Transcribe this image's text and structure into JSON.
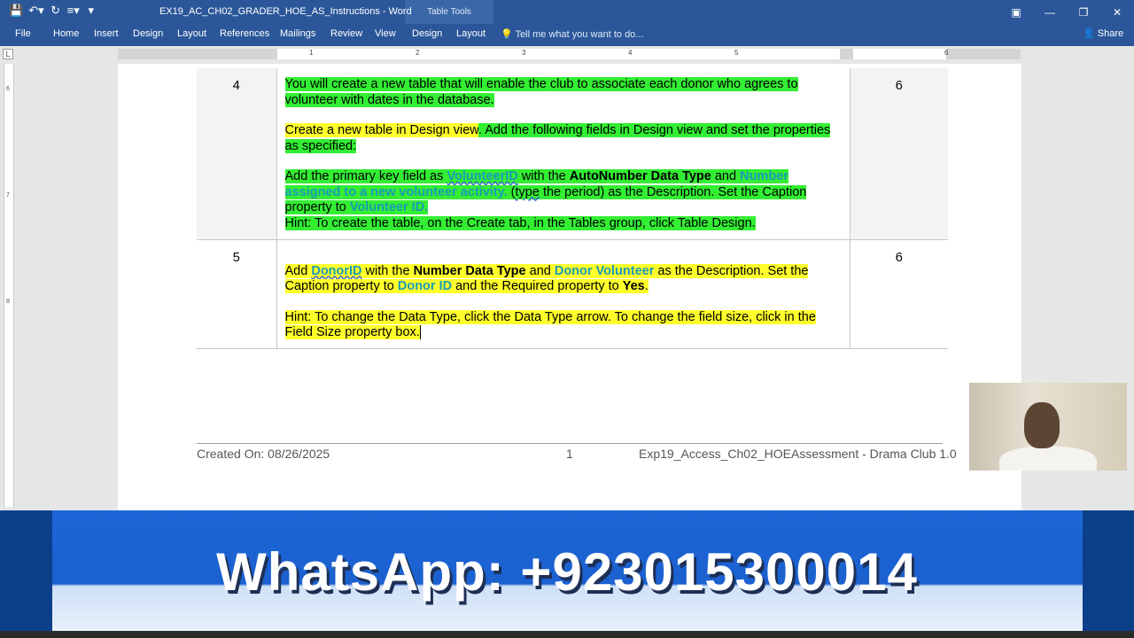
{
  "titlebar": {
    "title": "EX19_AC_CH02_GRADER_HOE_AS_Instructions - Word",
    "table_tools": "Table Tools",
    "qat_icons": [
      "save-icon",
      "undo-icon",
      "redo-icon",
      "numbering-icon",
      "customize-icon"
    ],
    "window_controls": [
      "ribbon-display-icon",
      "minimize-icon",
      "restore-icon",
      "close-icon"
    ]
  },
  "ribbon": {
    "tabs": [
      "File",
      "Home",
      "Insert",
      "Design",
      "Layout",
      "References",
      "Mailings",
      "Review",
      "View",
      "Design",
      "Layout"
    ],
    "tell_me": "Tell me what you want to do...",
    "share": "Share"
  },
  "ruler": {
    "h_numbers": [
      "1",
      "2",
      "3",
      "4",
      "5",
      "6"
    ],
    "v_numbers": [
      "6",
      "7",
      "8"
    ],
    "corner": "L"
  },
  "table": {
    "rows": [
      {
        "step": "4",
        "points": "6",
        "p1": "You will create a new table that will enable the club to associate each donor who agrees to volunteer with dates in the database.",
        "p2a": "Create a new table in Design view",
        "p2b": ". Add the following fields in Design view and set the properties as specified:",
        "p3_1": "Add the primary key field as ",
        "p3_2": "VolunteerID",
        "p3_3": " with the ",
        "p3_4": "AutoNumber Data Type",
        "p3_5": " and ",
        "p3_6": "Number assigned to a new volunteer activity.",
        "p3_7": " (",
        "p3_8": "type",
        "p3_9": " the period) as the Description. Set the Caption property to ",
        "p3_10": "Volunteer ID.",
        "p4": "Hint: To create the table, on the Create tab, in the Tables group, click Table Design."
      },
      {
        "step": "5",
        "points": "6",
        "p1_1": "Add ",
        "p1_2": "DonorID",
        "p1_3": " with the ",
        "p1_4": "Number Data Type",
        "p1_5": " and ",
        "p1_6": "Donor Volunteer",
        "p1_7": " as the Description. Set the Caption property to ",
        "p1_8": "Donor ID",
        "p1_9": " and the Required property to ",
        "p1_10": "Yes",
        "p1_11": ".",
        "p2": "Hint: To change the Data Type, click the Data Type arrow. To change the field size, click in the Field Size property box."
      }
    ]
  },
  "footer": {
    "created": "Created On: 08/26/2025",
    "page": "1",
    "doc": "Exp19_Access_Ch02_HOEAssessment - Drama Club 1.0"
  },
  "banner": {
    "text": "WhatsApp: +923015300014"
  },
  "colors": {
    "word_blue": "#2b579a",
    "highlight_green": "#33ee33",
    "highlight_yellow": "#ffff2b",
    "field_teal": "#1b9bb7"
  }
}
